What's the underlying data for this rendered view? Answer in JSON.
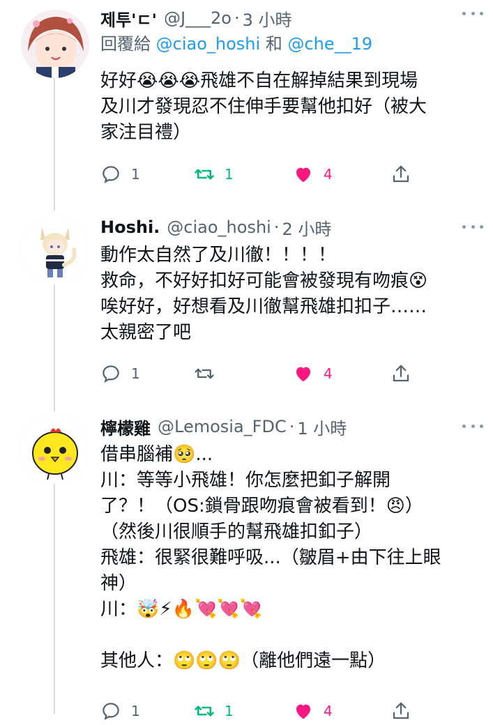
{
  "tweets": [
    {
      "name": "제투'ㄷ'",
      "handle": "@J___2o",
      "separator": "·",
      "time": "3 小時",
      "replying_prefix": "回覆給",
      "replying_1": "@ciao_hoshi",
      "replying_and": "和",
      "replying_2": "@che__19",
      "body": "好好😭😭😭飛雄不自在解掉結果到現場\n及川才發現忍不住伸手要幫他扣好（被大\n家注目禮）",
      "replies": "1",
      "retweets": "1",
      "likes": "4",
      "retweeted": true,
      "liked": true
    },
    {
      "name": "Hoshi.",
      "handle": "@ciao_hoshi",
      "separator": "·",
      "time": "2 小時",
      "body": "動作太自然了及川徹！！！！\n救命，不好好扣好可能會被發現有吻痕😵\n唉好好，好想看及川徹幫飛雄扣扣子……\n太親密了吧",
      "replies": "1",
      "retweets": "",
      "likes": "4",
      "retweeted": false,
      "liked": true
    },
    {
      "name": "檸檬雞",
      "handle": "@Lemosia_FDC",
      "separator": "·",
      "time": "1 小時",
      "body": "借串腦補🥺...\n川：等等小飛雄！你怎麼把釦子解開\n了？！（OS:鎖骨跟吻痕會被看到！😠）\n（然後川很順手的幫飛雄扣釦子）\n飛雄：很緊很難呼吸...（皺眉+由下往上眼\n神）\n川：🤯⚡🔥💘💘💘\n\n其他人：🙄🙄🙄（離他們遠一點）",
      "replies": "1",
      "retweets": "1",
      "likes": "4",
      "retweeted": true,
      "liked": true
    }
  ],
  "colors": {
    "accent_blue": "#1d9bf0",
    "retweet_green": "#00ba7c",
    "like_pink": "#f91880",
    "secondary_text": "#536471",
    "thread_line": "#cfd9de"
  },
  "icons": [
    "reply-icon",
    "retweet-icon",
    "like-icon",
    "share-icon",
    "more-icon"
  ]
}
